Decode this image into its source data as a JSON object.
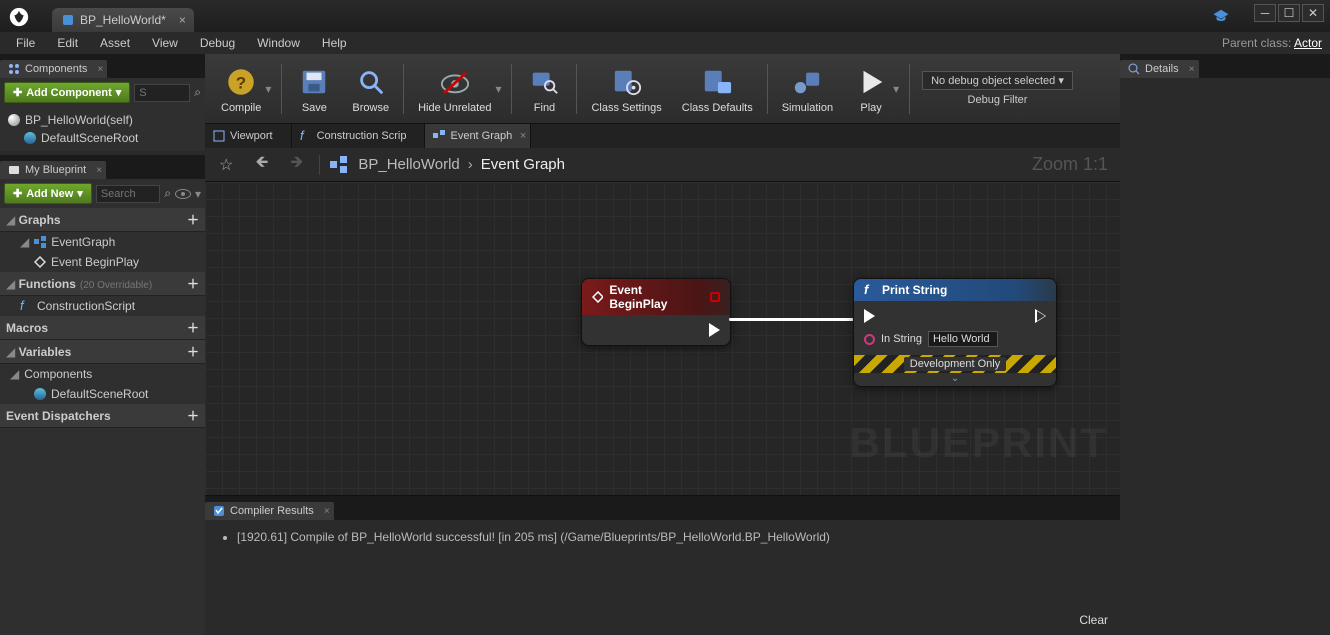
{
  "title_tab": "BP_HelloWorld*",
  "menu": {
    "file": "File",
    "edit": "Edit",
    "asset": "Asset",
    "view": "View",
    "debug": "Debug",
    "window": "Window",
    "help": "Help"
  },
  "parent_class_label": "Parent class:",
  "parent_class_value": "Actor",
  "components": {
    "panel_title": "Components",
    "add_btn": "Add Component",
    "search_placeholder": "S",
    "root": "BP_HelloWorld(self)",
    "child": "DefaultSceneRoot"
  },
  "my_blueprint": {
    "panel_title": "My Blueprint",
    "add_btn": "Add New",
    "search_placeholder": "Search",
    "sections": {
      "graphs": "Graphs",
      "event_graph": "EventGraph",
      "event_begin_play": "Event BeginPlay",
      "functions": "Functions",
      "functions_count": "(20 Overridable)",
      "construction_script": "ConstructionScript",
      "macros": "Macros",
      "variables": "Variables",
      "components_sec": "Components",
      "default_scene_root": "DefaultSceneRoot",
      "event_dispatchers": "Event Dispatchers"
    }
  },
  "toolbar": {
    "compile": "Compile",
    "save": "Save",
    "browse": "Browse",
    "hide_unrelated": "Hide Unrelated",
    "find": "Find",
    "class_settings": "Class Settings",
    "class_defaults": "Class Defaults",
    "simulation": "Simulation",
    "play": "Play",
    "debug_label": "Debug Filter",
    "debug_value": "No debug object selected"
  },
  "graph_tabs": {
    "viewport": "Viewport",
    "construction": "Construction Scrip",
    "event_graph": "Event Graph"
  },
  "breadcrumb": {
    "bp": "BP_HelloWorld",
    "current": "Event Graph"
  },
  "zoom": "Zoom 1:1",
  "watermark": "BLUEPRINT",
  "node_event": {
    "title": "Event BeginPlay"
  },
  "node_print": {
    "title": "Print String",
    "in_string_label": "In String",
    "in_string_value": "Hello World",
    "dev_only": "Development Only"
  },
  "compiler": {
    "panel_title": "Compiler Results",
    "message": "[1920.61] Compile of BP_HelloWorld successful! [in 205 ms] (/Game/Blueprints/BP_HelloWorld.BP_HelloWorld)",
    "clear": "Clear"
  },
  "details": {
    "panel_title": "Details"
  }
}
